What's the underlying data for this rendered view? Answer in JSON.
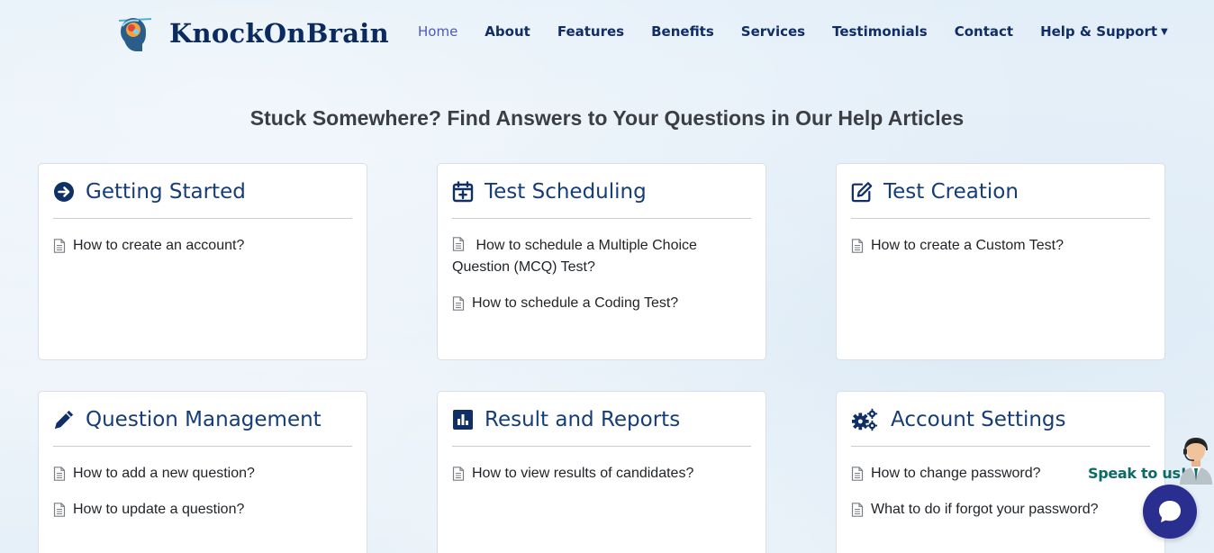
{
  "header": {
    "brand_name": "KnockOnBrain",
    "nav": [
      {
        "label": "Home",
        "active": true
      },
      {
        "label": "About"
      },
      {
        "label": "Features"
      },
      {
        "label": "Benefits"
      },
      {
        "label": "Services"
      },
      {
        "label": "Testimonials"
      },
      {
        "label": "Contact"
      },
      {
        "label": "Help & Support",
        "dropdown": true
      }
    ]
  },
  "main": {
    "heading": "Stuck Somewhere? Find Answers to Your Questions in Our Help Articles",
    "categories": [
      {
        "title": "Getting Started",
        "icon": "arrow-circle-right-icon",
        "articles": [
          "How to create an account?"
        ]
      },
      {
        "title": "Test Scheduling",
        "icon": "calendar-plus-icon",
        "articles": [
          "How to schedule a Multiple Choice Question (MCQ) Test?",
          "How to schedule a Coding Test?"
        ]
      },
      {
        "title": "Test Creation",
        "icon": "edit-icon",
        "articles": [
          "How to create a Custom Test?"
        ]
      },
      {
        "title": "Question Management",
        "icon": "pencil-icon",
        "articles": [
          "How to add a new question?",
          "How to update a question?"
        ]
      },
      {
        "title": "Result and Reports",
        "icon": "chart-bar-icon",
        "articles": [
          "How to view results of candidates?"
        ]
      },
      {
        "title": "Account Settings",
        "icon": "cogs-icon",
        "articles": [
          "How to change password?",
          "What to do if forgot your password?"
        ]
      }
    ]
  },
  "chat_widget": {
    "label": "Speak to us!"
  },
  "colors": {
    "nav_text": "#102d66",
    "nav_active": "#4a58c9",
    "card_title": "#153d78",
    "chat_button": "#2a2e8f",
    "speak_text": "#0d6b66"
  }
}
